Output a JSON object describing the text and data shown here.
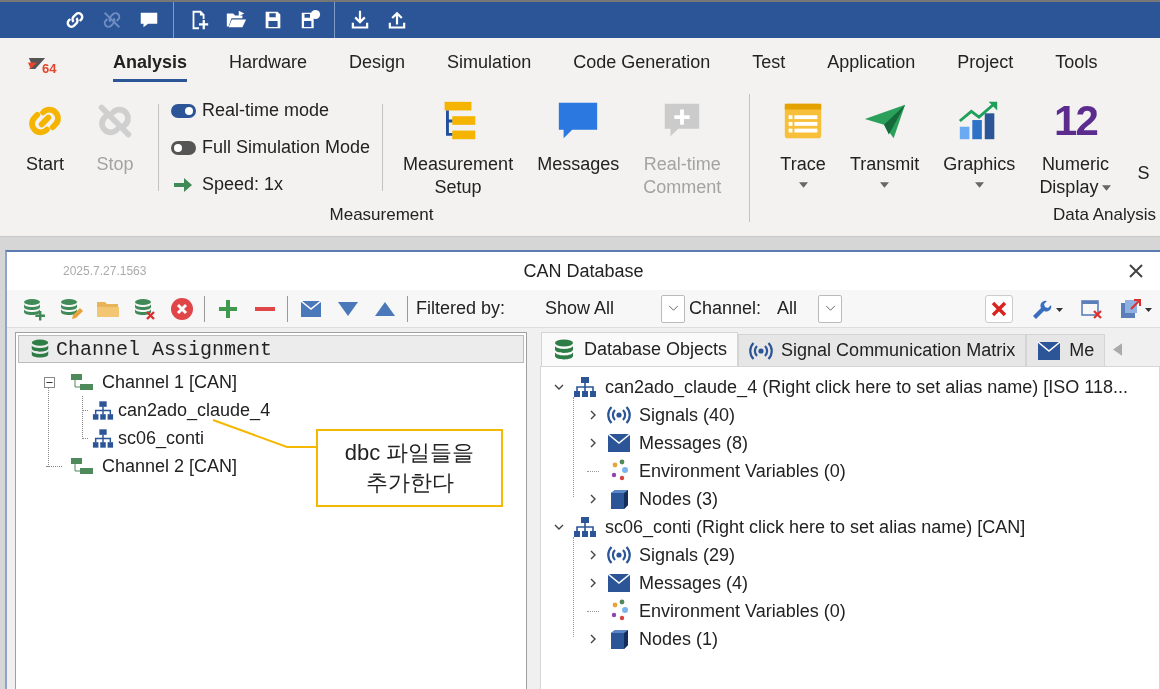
{
  "quick_access": [
    {
      "items": [
        {
          "kind": "link",
          "disabled": false
        },
        {
          "kind": "unlink",
          "disabled": true
        },
        {
          "kind": "comment",
          "disabled": false
        }
      ]
    },
    {
      "items": [
        {
          "kind": "new",
          "disabled": false
        },
        {
          "kind": "open",
          "disabled": false
        },
        {
          "kind": "save",
          "disabled": false
        },
        {
          "kind": "saveas",
          "disabled": false
        }
      ]
    },
    {
      "items": [
        {
          "kind": "download",
          "disabled": false
        },
        {
          "kind": "upload",
          "disabled": false
        }
      ]
    }
  ],
  "logo": {
    "text": "64"
  },
  "ribbon_tabs": [
    {
      "label": "Analysis",
      "selected": true
    },
    {
      "label": "Hardware",
      "selected": false
    },
    {
      "label": "Design",
      "selected": false
    },
    {
      "label": "Simulation",
      "selected": false
    },
    {
      "label": "Code Generation",
      "selected": false
    },
    {
      "label": "Test",
      "selected": false
    },
    {
      "label": "Application",
      "selected": false
    },
    {
      "label": "Project",
      "selected": false
    },
    {
      "label": "Tools",
      "selected": false
    }
  ],
  "ribbon_groups": [
    {
      "label": "Measurement",
      "items": [
        {
          "kind": "start",
          "label": "Start",
          "disabled": false
        },
        {
          "kind": "stop",
          "label": "Stop",
          "disabled": true
        },
        {
          "kind": "toggles",
          "toggles": [
            {
              "label": "Real-time mode",
              "on": true
            },
            {
              "label": "Full Simulation Mode",
              "on": false
            }
          ],
          "speed": "Speed: 1x"
        },
        {
          "kind": "setup",
          "label": "Measurement\nSetup",
          "disabled": false
        },
        {
          "kind": "messages",
          "label": "Messages",
          "disabled": false
        },
        {
          "kind": "comment",
          "label": "Real-time\nComment",
          "disabled": true
        }
      ]
    },
    {
      "label": "Data Analysis",
      "items": [
        {
          "kind": "trace",
          "label": "Trace",
          "disabled": false,
          "dropdown": true
        },
        {
          "kind": "transmit",
          "label": "Transmit",
          "disabled": false,
          "dropdown": true
        },
        {
          "kind": "graphics",
          "label": "Graphics",
          "disabled": false,
          "dropdown": true
        },
        {
          "kind": "numeric",
          "label": "Numeric\nDisplay",
          "icon_text": "12",
          "disabled": false,
          "dropdown": true
        },
        {
          "kind": "cut",
          "label": "S",
          "disabled": false
        }
      ]
    }
  ],
  "window": {
    "version": "2025.7.27.1563",
    "title": "CAN Database"
  },
  "toolbar": {
    "filter_label": "Filtered by:",
    "filter_value": "Show All",
    "channel_label": "Channel:",
    "channel_value": "All"
  },
  "channel_panel": {
    "title": "Channel Assignment",
    "tree": [
      {
        "label": "Channel 1 [CAN]",
        "expanded": true,
        "children": [
          {
            "label": "can2ado_claude_4"
          },
          {
            "label": "sc06_conti"
          }
        ]
      },
      {
        "label": "Channel 2 [CAN]"
      }
    ]
  },
  "callout": {
    "text": "dbc 파일들을\n추가한다"
  },
  "object_tabs": [
    {
      "kind": "database",
      "label": "Database Objects",
      "selected": true
    },
    {
      "kind": "signal",
      "label": "Signal Communication Matrix",
      "selected": false
    },
    {
      "kind": "message",
      "label": "Me",
      "selected": false
    }
  ],
  "objects": [
    {
      "label": "can2ado_claude_4 (Right click here to set alias name) [ISO 118...",
      "expanded": true,
      "children": [
        {
          "kind": "signal",
          "label": "Signals (40)",
          "expanded": false
        },
        {
          "kind": "message",
          "label": "Messages (8)",
          "expanded": false
        },
        {
          "kind": "env",
          "label": "Environment Variables (0)"
        },
        {
          "kind": "node",
          "label": "Nodes (3)",
          "expanded": false
        }
      ]
    },
    {
      "label": "sc06_conti (Right click here to set alias name) [CAN]",
      "expanded": true,
      "children": [
        {
          "kind": "signal",
          "label": "Signals (29)",
          "expanded": false
        },
        {
          "kind": "message",
          "label": "Messages (4)",
          "expanded": false
        },
        {
          "kind": "env",
          "label": "Environment Variables (0)"
        },
        {
          "kind": "node",
          "label": "Nodes (1)",
          "expanded": false
        }
      ]
    }
  ]
}
